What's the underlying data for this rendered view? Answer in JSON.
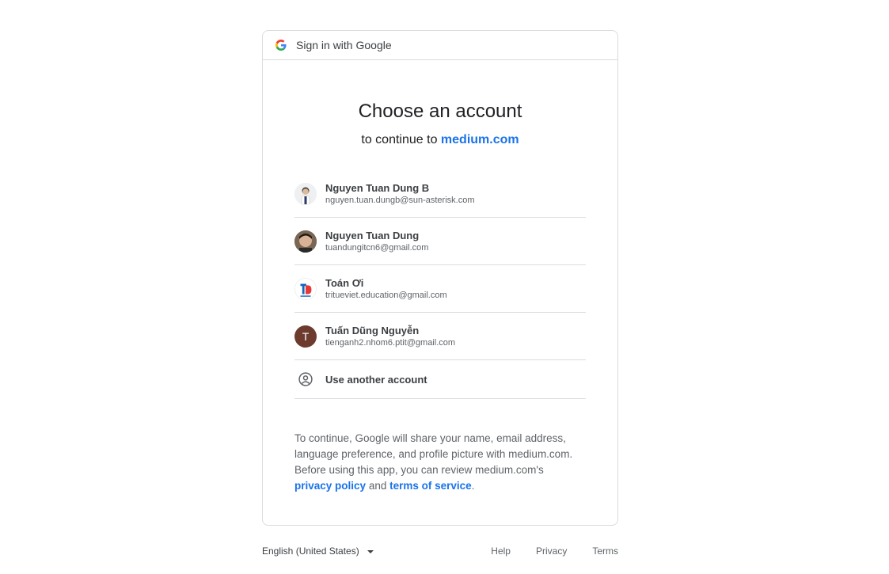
{
  "header": {
    "text": "Sign in with Google",
    "logo_icon": "google-g-icon"
  },
  "title": "Choose an account",
  "subtitle": {
    "prefix": "to continue to",
    "link": "medium.com"
  },
  "accounts": [
    {
      "name": "Nguyen Tuan Dung B",
      "email": "nguyen.tuan.dungb@sun-asterisk.com",
      "avatar": "photo"
    },
    {
      "name": "Nguyen Tuan Dung",
      "email": "tuandungitcn6@gmail.com",
      "avatar": "photo"
    },
    {
      "name": "Toán Ơi",
      "email": "tritueviet.education@gmail.com",
      "avatar": "logo"
    },
    {
      "name": "Tuấn Dũng Nguyễn",
      "email": "tienganh2.nhom6.ptit@gmail.com",
      "avatar": "letter",
      "letter": "T"
    }
  ],
  "other_account": {
    "label": "Use another account",
    "icon": "account-circle-icon"
  },
  "consent": {
    "text": "To continue, Google will share your name, email address, language preference, and profile picture with medium.com. Before using this app, you can review medium.com's",
    "privacy_link": "privacy policy",
    "and": "and",
    "terms_link": "terms of service",
    "period": "."
  },
  "footer": {
    "language": "English (United States)",
    "links": [
      "Help",
      "Privacy",
      "Terms"
    ]
  },
  "colors": {
    "link": "#1a73e8",
    "border": "#dadce0",
    "text": "#202124",
    "muted": "#5f6368"
  }
}
